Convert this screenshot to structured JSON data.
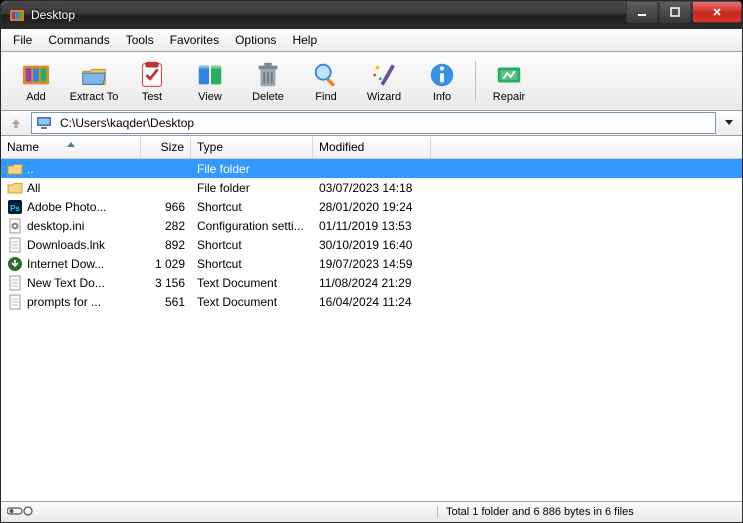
{
  "window": {
    "title": "Desktop"
  },
  "menu": {
    "items": [
      "File",
      "Commands",
      "Tools",
      "Favorites",
      "Options",
      "Help"
    ]
  },
  "toolbar": {
    "buttons": [
      {
        "id": "add",
        "label": "Add"
      },
      {
        "id": "extract",
        "label": "Extract To"
      },
      {
        "id": "test",
        "label": "Test"
      },
      {
        "id": "view",
        "label": "View"
      },
      {
        "id": "delete",
        "label": "Delete"
      },
      {
        "id": "find",
        "label": "Find"
      },
      {
        "id": "wizard",
        "label": "Wizard"
      },
      {
        "id": "info",
        "label": "Info"
      }
    ],
    "buttons2": [
      {
        "id": "repair",
        "label": "Repair"
      }
    ]
  },
  "address": {
    "path": "C:\\Users\\kaqder\\Desktop"
  },
  "columns": {
    "name": "Name",
    "size": "Size",
    "type": "Type",
    "modified": "Modified",
    "sort": "name",
    "dir": "asc"
  },
  "files": [
    {
      "icon": "folder-up",
      "name": "..",
      "size": "",
      "type": "File folder",
      "modified": "",
      "selected": true
    },
    {
      "icon": "folder",
      "name": "All",
      "size": "",
      "type": "File folder",
      "modified": "03/07/2023 14:18"
    },
    {
      "icon": "ps",
      "name": "Adobe Photo...",
      "size": "966",
      "type": "Shortcut",
      "modified": "28/01/2020 19:24"
    },
    {
      "icon": "ini",
      "name": "desktop.ini",
      "size": "282",
      "type": "Configuration setti...",
      "modified": "01/11/2019 13:53"
    },
    {
      "icon": "doc",
      "name": "Downloads.lnk",
      "size": "892",
      "type": "Shortcut",
      "modified": "30/10/2019 16:40"
    },
    {
      "icon": "idm",
      "name": "Internet Dow...",
      "size": "1 029",
      "type": "Shortcut",
      "modified": "19/07/2023 14:59"
    },
    {
      "icon": "doc",
      "name": "New Text Do...",
      "size": "3 156",
      "type": "Text Document",
      "modified": "11/08/2024 21:29"
    },
    {
      "icon": "doc",
      "name": "prompts for ...",
      "size": "561",
      "type": "Text Document",
      "modified": "16/04/2024 11:24"
    }
  ],
  "status": {
    "summary": "Total 1 folder and 6 886 bytes in 6 files"
  }
}
